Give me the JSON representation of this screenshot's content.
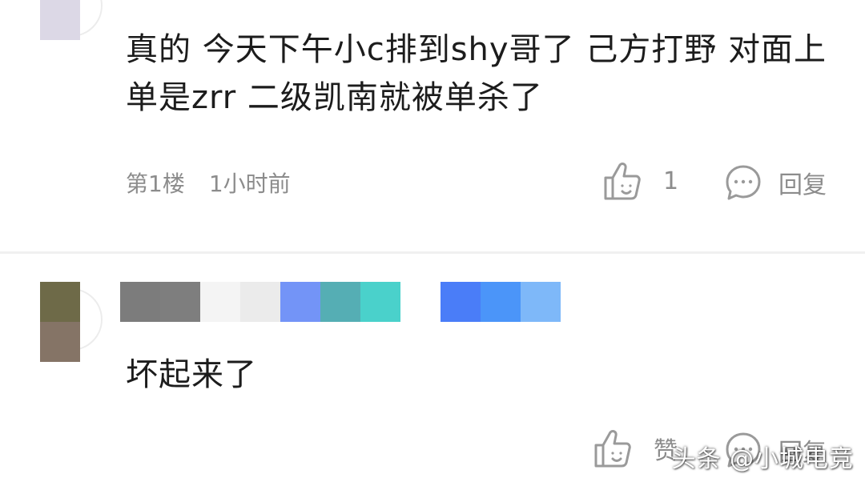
{
  "comments": [
    {
      "text": "真的 今天下午小c排到shy哥了 己方打野 对面上单是zrr 二级凯南就被单杀了",
      "floor": "第1楼",
      "time": "1小时前",
      "like_icon": "thumbs-up-icon",
      "like_count": "1",
      "reply_icon": "chat-bubble-icon",
      "reply_label": "回复",
      "avatar_colors": [
        "#dcd8e6"
      ]
    },
    {
      "text": "坏起来了",
      "like_icon": "thumbs-up-icon",
      "like_label": "赞",
      "reply_icon": "chat-bubble-icon",
      "reply_label": "回复",
      "avatar_colors": [
        "#6e6a48",
        "#857466"
      ],
      "username_mosaic_colors": [
        "#7c7c7c",
        "#7e7e7e",
        "#f4f4f4",
        "#ebebeb",
        "#7394f7",
        "#55aeb4",
        "#4ad1cb",
        "#ffffff",
        "#4a7df8",
        "#4b95f9",
        "#7eb8f9"
      ]
    }
  ],
  "watermark": "头条 @小城电竞"
}
